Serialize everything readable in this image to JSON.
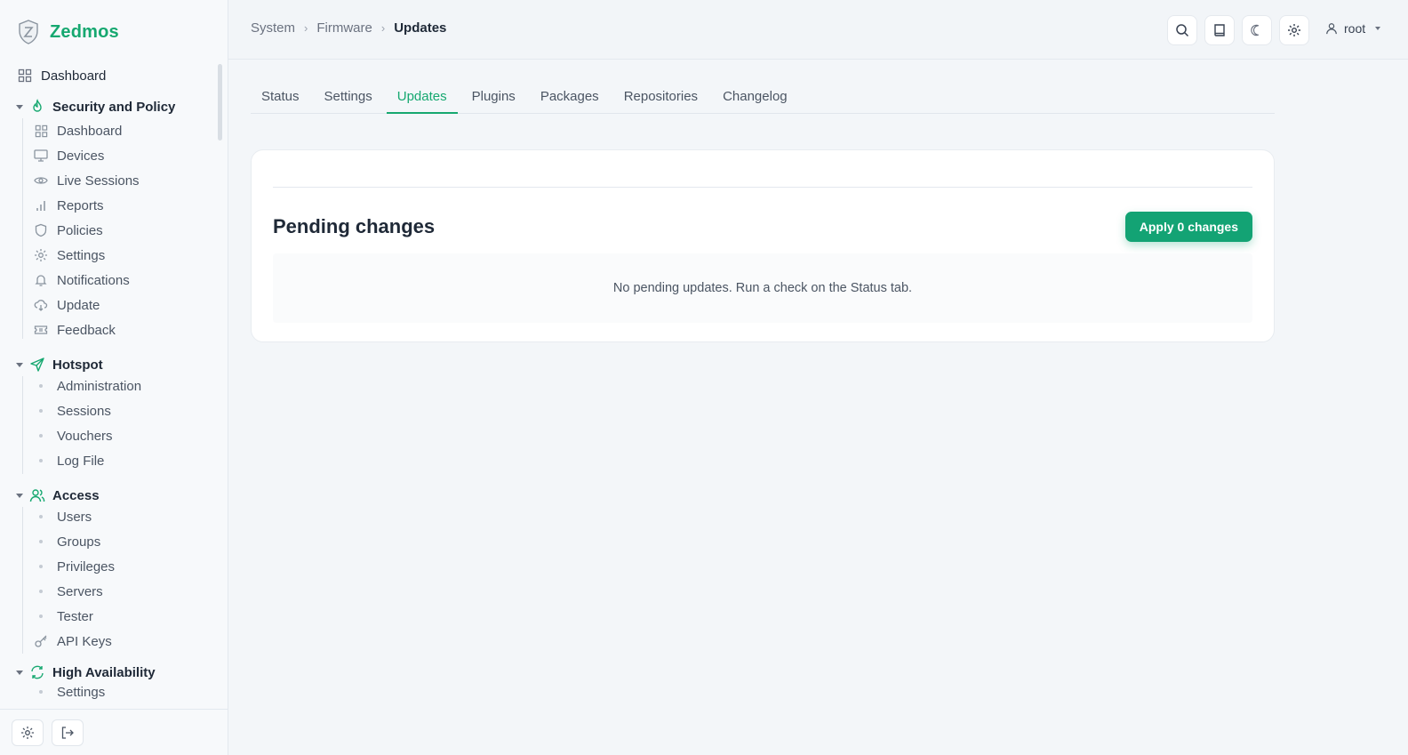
{
  "brand": {
    "name": "Zedmos",
    "accent": "#16a870"
  },
  "sidebar": {
    "top_item": "Dashboard",
    "sections": [
      {
        "title": "Security and Policy",
        "icon": "flame-icon",
        "items": [
          {
            "label": "Dashboard",
            "icon": "dashboard-icon"
          },
          {
            "label": "Devices",
            "icon": "monitor-icon"
          },
          {
            "label": "Live Sessions",
            "icon": "eye-icon"
          },
          {
            "label": "Reports",
            "icon": "bar-chart-icon"
          },
          {
            "label": "Policies",
            "icon": "shield-icon"
          },
          {
            "label": "Settings",
            "icon": "gear-icon"
          },
          {
            "label": "Notifications",
            "icon": "bell-icon"
          },
          {
            "label": "Update",
            "icon": "cloud-download-icon"
          },
          {
            "label": "Feedback",
            "icon": "ticket-icon"
          }
        ]
      },
      {
        "title": "Hotspot",
        "icon": "send-icon",
        "items": [
          {
            "label": "Administration"
          },
          {
            "label": "Sessions"
          },
          {
            "label": "Vouchers"
          },
          {
            "label": "Log File"
          }
        ]
      },
      {
        "title": "Access",
        "icon": "users-icon",
        "items": [
          {
            "label": "Users"
          },
          {
            "label": "Groups"
          },
          {
            "label": "Privileges"
          },
          {
            "label": "Servers"
          },
          {
            "label": "Tester"
          },
          {
            "label": "API Keys",
            "icon": "key-icon"
          }
        ]
      },
      {
        "title": "High Availability",
        "icon": "refresh-icon",
        "items": [
          {
            "label": "Settings"
          }
        ]
      }
    ]
  },
  "breadcrumb": [
    "System",
    "Firmware",
    "Updates"
  ],
  "header": {
    "user": "root"
  },
  "tabs": [
    "Status",
    "Settings",
    "Updates",
    "Plugins",
    "Packages",
    "Repositories",
    "Changelog"
  ],
  "active_tab": "Updates",
  "card": {
    "title": "Pending changes",
    "apply_button": "Apply 0 changes",
    "empty_message": "No pending updates. Run a check on the Status tab."
  }
}
